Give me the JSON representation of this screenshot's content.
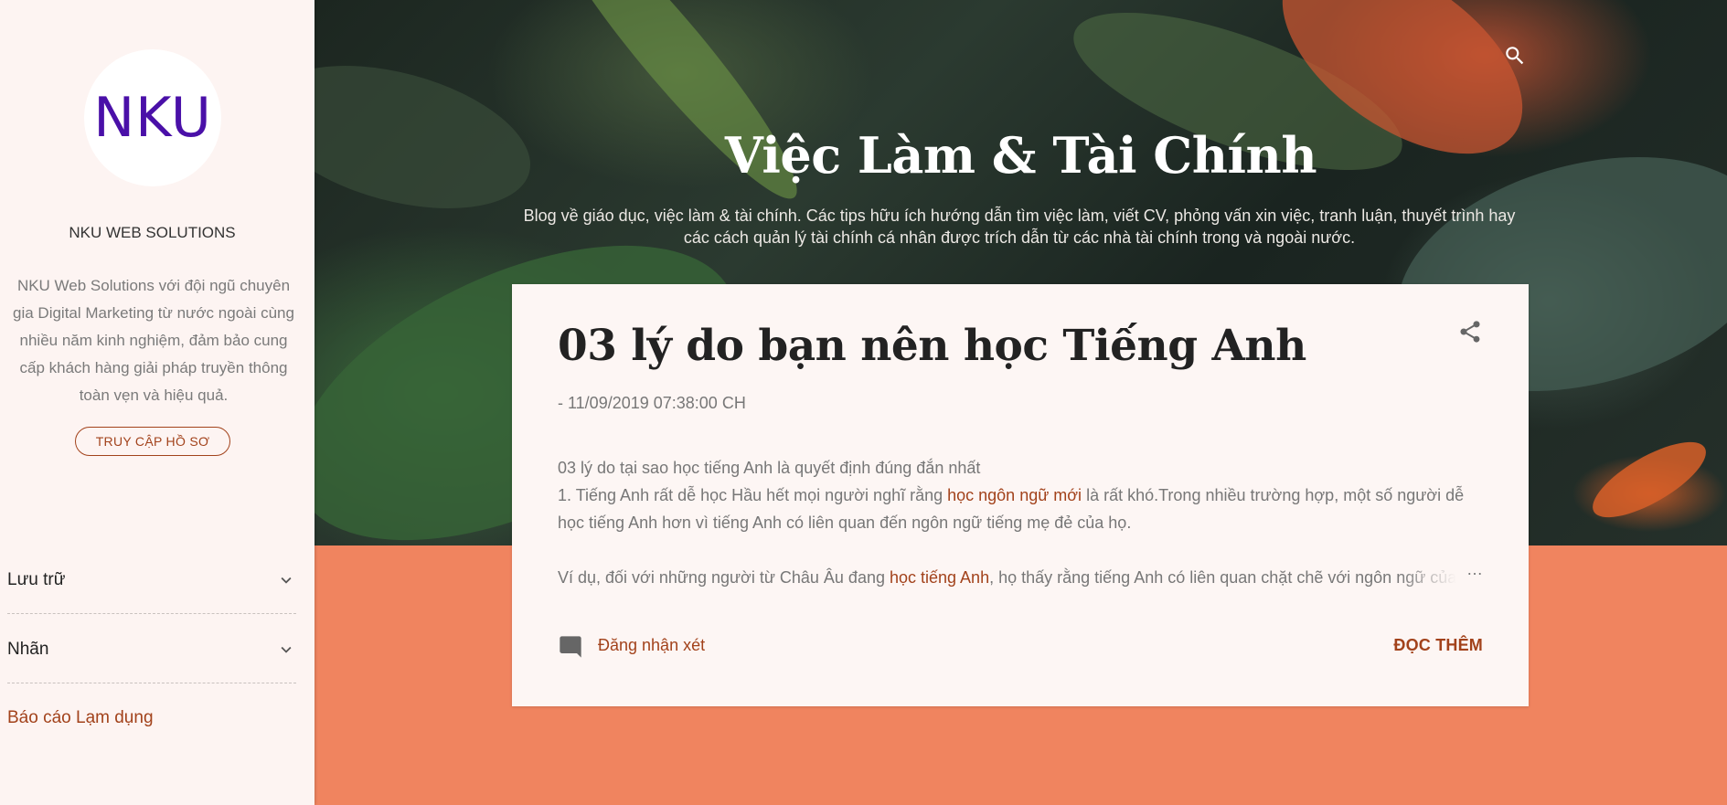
{
  "sidebar": {
    "logo_text": "NKU",
    "profile_name": "NKU WEB SOLUTIONS",
    "profile_description": "NKU Web Solutions với đội ngũ chuyên gia Digital Marketing từ nước ngoài cùng nhiều năm kinh nghiệm, đảm bảo cung cấp khách hàng giải pháp truyền thông toàn vẹn và hiệu quả.",
    "profile_button": "TRUY CẬP HỒ SƠ",
    "sections": [
      {
        "label": "Lưu trữ"
      },
      {
        "label": "Nhãn"
      }
    ],
    "report_link": "Báo cáo Lạm dụng"
  },
  "header": {
    "title": "Việc Làm & Tài Chính",
    "description": "Blog về giáo dục, việc làm & tài chính. Các tips hữu ích hướng dẫn tìm việc làm, viết CV, phỏng vấn xin việc, tranh luận, thuyết trình hay các cách quản lý tài chính cá nhân được trích dẫn từ các nhà tài chính trong và ngoài nước."
  },
  "post": {
    "title": "03 lý do bạn nên học Tiếng Anh",
    "date": "- 11/09/2019 07:38:00 CH",
    "para1_line1": "03 lý do tại sao học tiếng Anh là quyết định đúng đắn nhất",
    "para1_line2_pre": "1. Tiếng Anh rất dễ học Hầu hết mọi người nghĩ rằng ",
    "para1_link": "học ngôn ngữ mới",
    "para1_line2_post": " là rất khó.Trong nhiều trường hợp, một số người dễ học tiếng Anh hơn vì tiếng Anh có liên quan đến ngôn ngữ tiếng mẹ đẻ của họ.",
    "para2_pre": "Ví dụ, đối với những người từ Châu Âu đang ",
    "para2_link": "học tiếng Anh",
    "para2_post": ", họ thấy rằng tiếng Anh có liên quan chặt chẽ với ngôn ngữ của",
    "ellipsis": "…",
    "comment_label": "Đăng nhận xét",
    "read_more": "ĐỌC THÊM"
  },
  "colors": {
    "accent": "#a2421b",
    "orange_band": "#f0845f",
    "logo_text": "#4a10a8",
    "sidebar_bg": "#fdf4f2"
  },
  "icons": [
    "search-icon",
    "share-icon",
    "comment-icon",
    "chevron-down-icon"
  ]
}
